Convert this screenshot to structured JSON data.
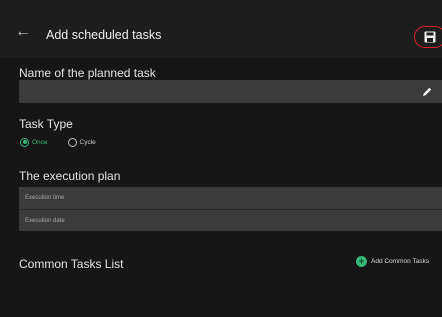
{
  "header": {
    "back_icon": "arrow-left-icon",
    "title": "Add scheduled tasks",
    "save_icon": "save-icon",
    "save_highlight_color": "#d7242a"
  },
  "task_name": {
    "label": "Name of the planned task",
    "value": "",
    "edit_icon": "pencil-icon"
  },
  "task_type": {
    "label": "Task Type",
    "options": [
      {
        "label": "Once",
        "selected": true
      },
      {
        "label": "Cycle",
        "selected": false
      }
    ],
    "accent_color": "#32b77a"
  },
  "execution_plan": {
    "label": "The execution plan",
    "time_placeholder": "Execution time",
    "date_placeholder": "Execution date"
  },
  "common_tasks": {
    "label": "Common Tasks List",
    "add_button_label": "Add Common Tasks",
    "add_icon": "plus-circle-icon"
  }
}
